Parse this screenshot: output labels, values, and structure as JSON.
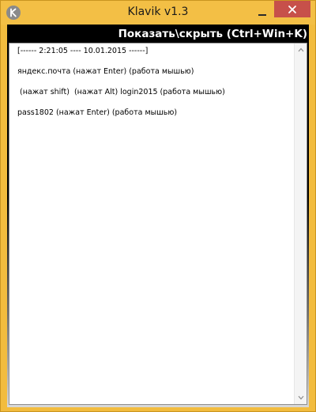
{
  "window": {
    "title": "Klavik v1.3",
    "close_icon": "close-icon",
    "minimize_icon": "minimize-icon",
    "app_icon": "klavik-app-icon"
  },
  "header": {
    "hotkey_label": "Показать\\скрыть (Ctrl+Win+K)"
  },
  "log": {
    "lines": [
      "[------ 2:21:05 ---- 10.01.2015 ------]",
      "яндекс.почта (нажат Enter)  (работа мышью)",
      " (нажат shift)  (нажат Alt) login2015 (работа мышью)",
      "pass1802 (нажат Enter)  (работа мышью)"
    ]
  },
  "colors": {
    "titlebar": "#f3bf45",
    "close_button": "#c7504a",
    "header_background": "#000000",
    "header_text": "#ffffff"
  }
}
